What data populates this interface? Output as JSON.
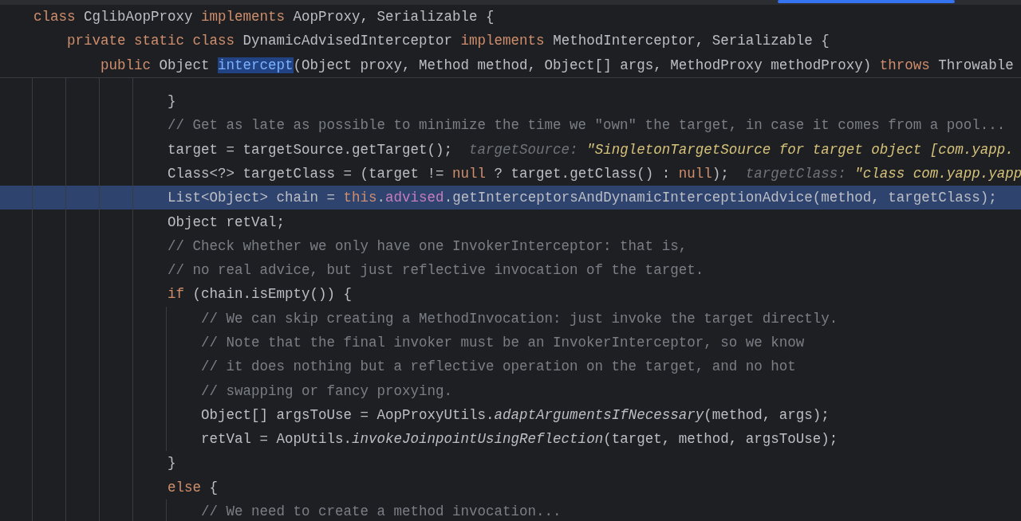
{
  "sticky_header": [
    {
      "tokens": [
        {
          "text": "class ",
          "kind": "kw"
        },
        {
          "text": "CglibAopProxy ",
          "kind": "plain"
        },
        {
          "text": "implements ",
          "kind": "kw"
        },
        {
          "text": "AopProxy, Serializable {",
          "kind": "plain"
        }
      ]
    },
    {
      "tokens": [
        {
          "text": "    private static class ",
          "kind": "kw"
        },
        {
          "text": "DynamicAdvisedInterceptor ",
          "kind": "plain"
        },
        {
          "text": "implements ",
          "kind": "kw"
        },
        {
          "text": "MethodInterceptor, Serializable {",
          "kind": "plain"
        }
      ]
    },
    {
      "tokens": [
        {
          "text": "        public ",
          "kind": "kw"
        },
        {
          "text": "Object ",
          "kind": "plain"
        },
        {
          "text": "intercept",
          "kind": "match"
        },
        {
          "text": "(Object proxy, Method method, Object[] args, MethodProxy methodProxy) ",
          "kind": "plain"
        },
        {
          "text": "throws ",
          "kind": "kw"
        },
        {
          "text": "Throwable",
          "kind": "plain"
        }
      ]
    }
  ],
  "lines": [
    {
      "selected": false,
      "tokens": [
        {
          "text": "                }",
          "kind": "plain"
        }
      ]
    },
    {
      "selected": false,
      "tokens": [
        {
          "text": "                // Get as late as possible to minimize the time we \"own\" the target, in case it comes from a pool...",
          "kind": "comment"
        }
      ]
    },
    {
      "selected": false,
      "tokens": [
        {
          "text": "                target = targetSource.getTarget();",
          "kind": "plain"
        }
      ],
      "hint": {
        "label": "targetSource:",
        "value": "\"SingletonTargetSource for target object [com.yapp."
      }
    },
    {
      "selected": false,
      "tokens": [
        {
          "text": "                Class<?> targetClass = (target != ",
          "kind": "plain"
        },
        {
          "text": "null",
          "kind": "kw"
        },
        {
          "text": " ? target.getClass() : ",
          "kind": "plain"
        },
        {
          "text": "null",
          "kind": "kw"
        },
        {
          "text": ");",
          "kind": "plain"
        }
      ],
      "hint": {
        "label": "targetClass:",
        "value": "\"class com.yapp.yapp"
      }
    },
    {
      "selected": true,
      "tokens": [
        {
          "text": "                List<Object> chain = ",
          "kind": "plain"
        },
        {
          "text": "this",
          "kind": "kw"
        },
        {
          "text": ".",
          "kind": "plain"
        },
        {
          "text": "advised",
          "kind": "field"
        },
        {
          "text": ".getInterceptorsAndDynamicInterceptionAdvice(method, targetClass);",
          "kind": "plain"
        }
      ]
    },
    {
      "selected": false,
      "tokens": [
        {
          "text": "                Object retVal;",
          "kind": "plain"
        }
      ]
    },
    {
      "selected": false,
      "tokens": [
        {
          "text": "                // Check whether we only have one InvokerInterceptor: that is,",
          "kind": "comment"
        }
      ]
    },
    {
      "selected": false,
      "tokens": [
        {
          "text": "                // no real advice, but just reflective invocation of the target.",
          "kind": "comment"
        }
      ]
    },
    {
      "selected": false,
      "tokens": [
        {
          "text": "                if ",
          "kind": "kw"
        },
        {
          "text": "(chain.isEmpty()) {",
          "kind": "plain"
        }
      ]
    },
    {
      "selected": false,
      "tokens": [
        {
          "text": "                    // We can skip creating a MethodInvocation: just invoke the target directly.",
          "kind": "comment"
        }
      ]
    },
    {
      "selected": false,
      "tokens": [
        {
          "text": "                    // Note that the final invoker must be an InvokerInterceptor, so we know",
          "kind": "comment"
        }
      ]
    },
    {
      "selected": false,
      "tokens": [
        {
          "text": "                    // it does nothing but a reflective operation on the target, and no hot",
          "kind": "comment"
        }
      ]
    },
    {
      "selected": false,
      "tokens": [
        {
          "text": "                    // swapping or fancy proxying.",
          "kind": "comment"
        }
      ]
    },
    {
      "selected": false,
      "tokens": [
        {
          "text": "                    Object[] argsToUse = AopProxyUtils.",
          "kind": "plain"
        },
        {
          "text": "adaptArgumentsIfNecessary",
          "kind": "call"
        },
        {
          "text": "(method, args);",
          "kind": "plain"
        }
      ]
    },
    {
      "selected": false,
      "tokens": [
        {
          "text": "                    retVal = AopUtils.",
          "kind": "plain"
        },
        {
          "text": "invokeJoinpointUsingReflection",
          "kind": "call"
        },
        {
          "text": "(target, method, argsToUse);",
          "kind": "plain"
        }
      ]
    },
    {
      "selected": false,
      "tokens": [
        {
          "text": "                }",
          "kind": "plain"
        }
      ]
    },
    {
      "selected": false,
      "tokens": [
        {
          "text": "                else ",
          "kind": "kw"
        },
        {
          "text": "{",
          "kind": "plain"
        }
      ]
    },
    {
      "selected": false,
      "tokens": [
        {
          "text": "                    // We need to create a method invocation...",
          "kind": "comment"
        }
      ]
    }
  ]
}
